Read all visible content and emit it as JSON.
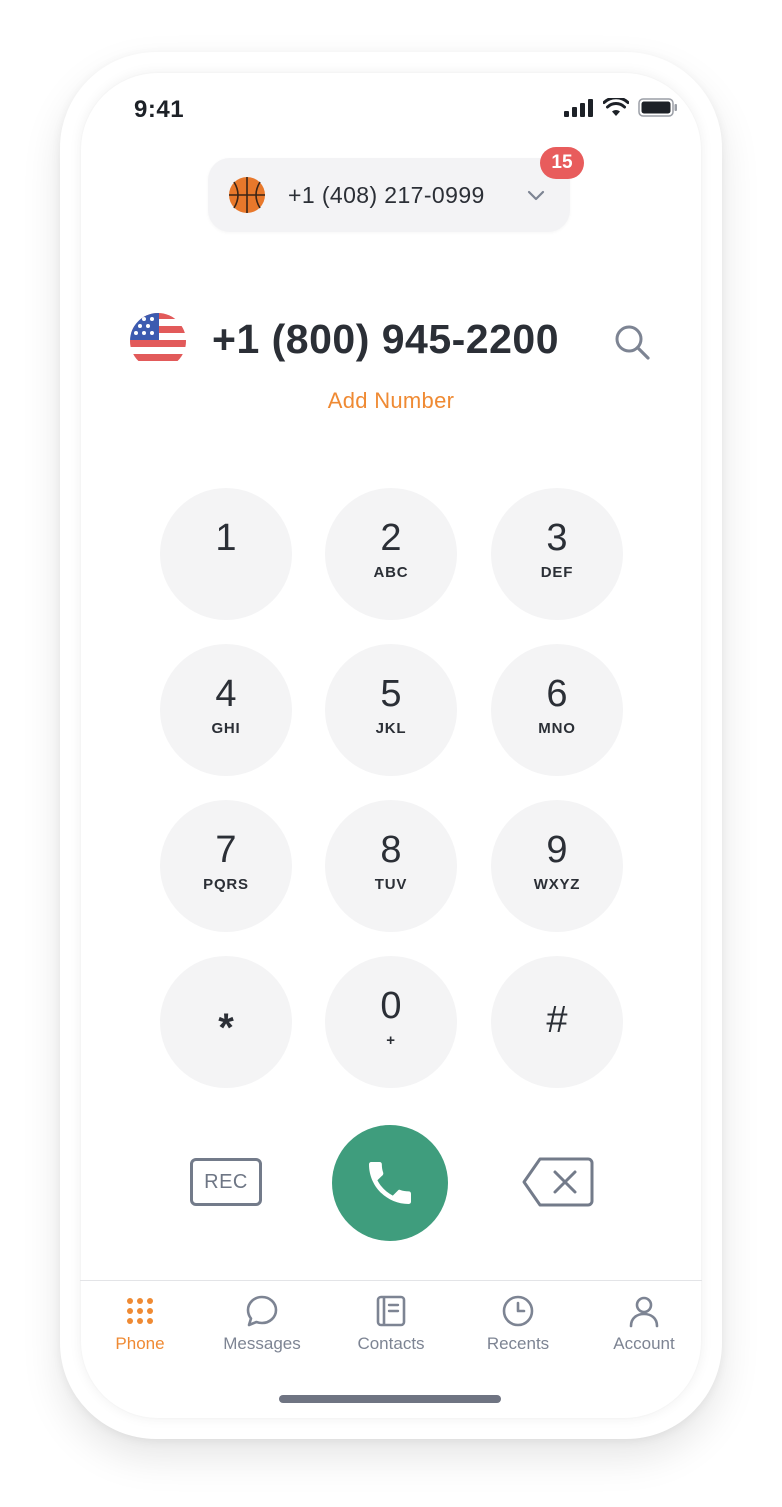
{
  "status_bar": {
    "time": "9:41",
    "icons": [
      "signal-icon",
      "wifi-icon",
      "battery-icon"
    ]
  },
  "line_selector": {
    "avatar_icon": "basketball-icon",
    "number": "+1 (408) 217-0999",
    "dropdown_icon": "chevron-down-icon",
    "badge_count": "15"
  },
  "dialer": {
    "country_flag_icon": "us-flag-icon",
    "number": "+1 (800) 945-2200",
    "search_icon": "search-icon",
    "add_number_label": "Add Number"
  },
  "keypad": {
    "keys": [
      {
        "digit": "1",
        "letters": ""
      },
      {
        "digit": "2",
        "letters": "ABC"
      },
      {
        "digit": "3",
        "letters": "DEF"
      },
      {
        "digit": "4",
        "letters": "GHI"
      },
      {
        "digit": "5",
        "letters": "JKL"
      },
      {
        "digit": "6",
        "letters": "MNO"
      },
      {
        "digit": "7",
        "letters": "PQRS"
      },
      {
        "digit": "8",
        "letters": "TUV"
      },
      {
        "digit": "9",
        "letters": "WXYZ"
      },
      {
        "digit": "*",
        "letters": ""
      },
      {
        "digit": "0",
        "letters": "+"
      },
      {
        "digit": "#",
        "letters": ""
      }
    ]
  },
  "actions": {
    "rec_label": "REC",
    "call_icon": "phone-icon",
    "delete_icon": "backspace-icon"
  },
  "tabs": [
    {
      "label": "Phone",
      "icon": "dialpad-icon",
      "active": true
    },
    {
      "label": "Messages",
      "icon": "message-bubble-icon",
      "active": false
    },
    {
      "label": "Contacts",
      "icon": "contacts-book-icon",
      "active": false
    },
    {
      "label": "Recents",
      "icon": "clock-icon",
      "active": false
    },
    {
      "label": "Account",
      "icon": "user-icon",
      "active": false
    }
  ],
  "colors": {
    "accent": "#ef8a33",
    "call_green": "#3f9d7d",
    "badge_red": "#e85c5c",
    "key_background": "#f4f4f5",
    "inactive_tab": "#7d8493"
  }
}
